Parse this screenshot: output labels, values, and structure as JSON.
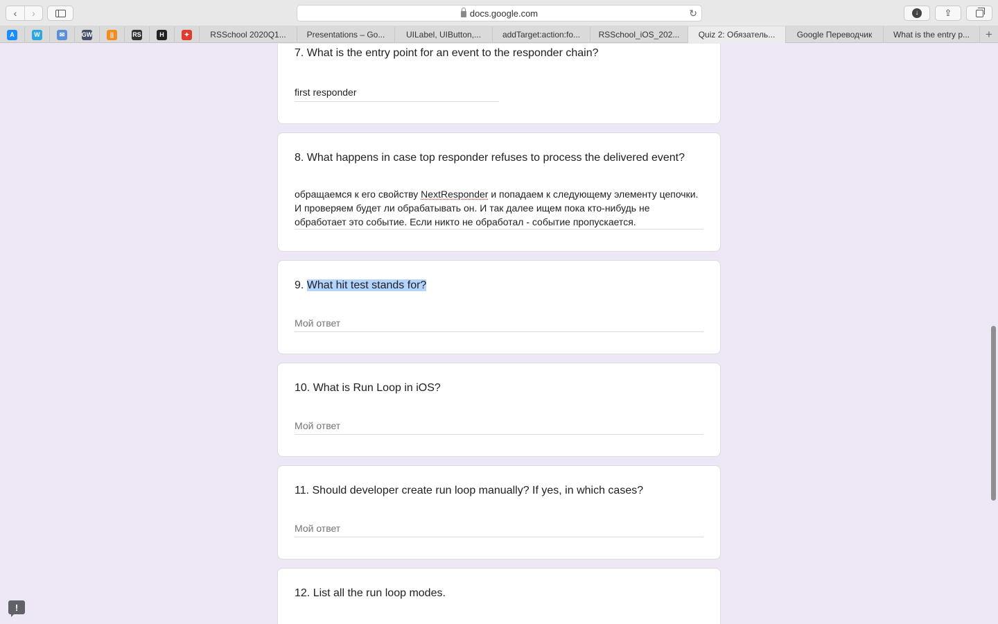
{
  "browser": {
    "url_host": "docs.google.com",
    "reload_glyph": "↻",
    "download_glyph": "↓",
    "share_glyph": "⇪",
    "back_glyph": "‹",
    "forward_glyph": "›",
    "new_tab_glyph": "+"
  },
  "pinned_tabs": [
    {
      "icon": "app-store-icon",
      "glyph": "A",
      "color": "#1a8cff"
    },
    {
      "icon": "w-logo-icon",
      "glyph": "W",
      "color": "#2aa6e0"
    },
    {
      "icon": "mail-icon",
      "glyph": "✉",
      "color": "#5b8fd9"
    },
    {
      "icon": "gw-icon",
      "glyph": "GW",
      "color": "#454f6b"
    },
    {
      "icon": "bars-icon",
      "glyph": "||",
      "color": "#f28b20"
    },
    {
      "icon": "rs-icon",
      "glyph": "RS",
      "color": "#333333"
    },
    {
      "icon": "habr-icon",
      "glyph": "H",
      "color": "#222222"
    },
    {
      "icon": "red-cat-icon",
      "glyph": "✦",
      "color": "#e23b2e"
    }
  ],
  "tabs": [
    {
      "label": "RSSchool 2020Q1...",
      "active": false
    },
    {
      "label": "Presentations – Go...",
      "active": false
    },
    {
      "label": "UILabel, UIButton,...",
      "active": false
    },
    {
      "label": "addTarget:action:fo...",
      "active": false
    },
    {
      "label": "RSSchool_iOS_202...",
      "active": false
    },
    {
      "label": "Quiz 2: Обязатель...",
      "active": true
    },
    {
      "label": "Google Переводчик",
      "active": false
    },
    {
      "label": "What is the entry p...",
      "active": false
    }
  ],
  "form": {
    "q7": {
      "title": "7. What is the entry point for an event to the responder chain?",
      "answer": "first responder"
    },
    "q8": {
      "title": "8. What happens in case top responder refuses to process the delivered event?",
      "answer_before": "обращаемся к его свойству ",
      "answer_spell": "NextResponder",
      "answer_after": " и попадаем к следующему элементу цепочки. И проверяем будет ли обрабатывать он. И так далее ищем пока кто-нибудь не обработает это событие. Если никто не обработал - событие пропускается."
    },
    "q9": {
      "number": "9. ",
      "title_highlighted": "What hit test stands for?",
      "placeholder": "Мой ответ"
    },
    "q10": {
      "title": "10. What is Run Loop in iOS?",
      "placeholder": "Мой ответ"
    },
    "q11": {
      "title": "11. Should developer create run loop manually? If yes, in which cases?",
      "placeholder": "Мой ответ"
    },
    "q12": {
      "title": "12. List all the run loop modes."
    }
  },
  "feedback": {
    "glyph": "!"
  }
}
